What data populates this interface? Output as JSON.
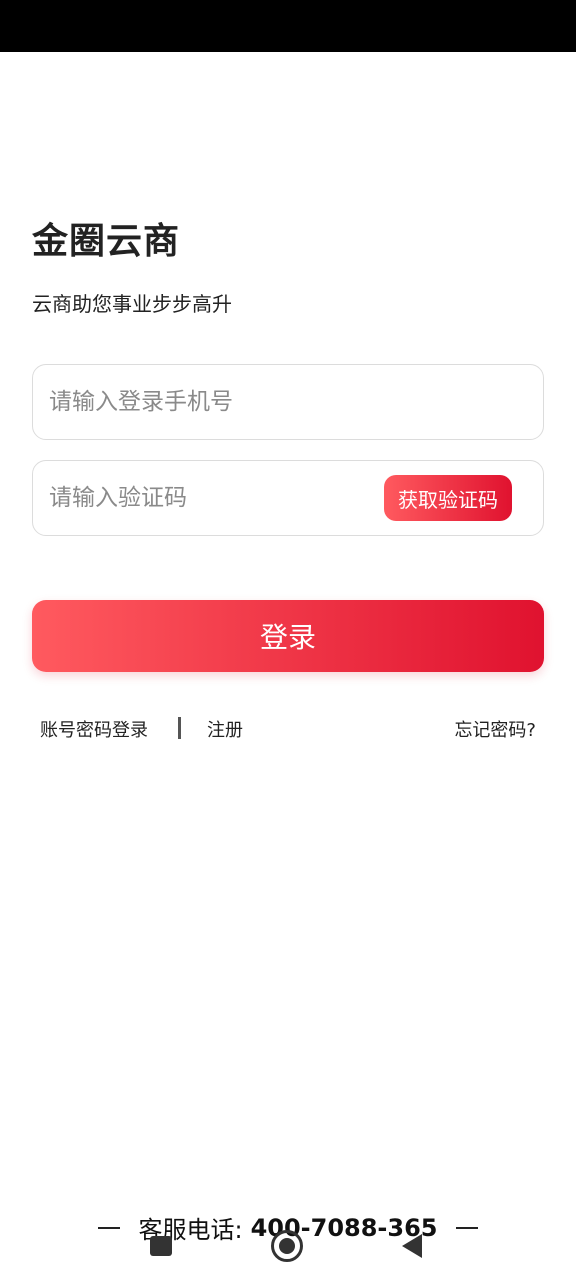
{
  "header": {
    "title": "金圈云商",
    "subtitle": "云商助您事业步步高升"
  },
  "form": {
    "phone_placeholder": "请输入登录手机号",
    "code_placeholder": "请输入验证码",
    "get_code_label": "获取验证码",
    "login_label": "登录"
  },
  "links": {
    "password_login": "账号密码登录",
    "register": "注册",
    "forgot_password": "忘记密码?"
  },
  "service": {
    "label": "客服电话:",
    "phone": "400-7088-365"
  },
  "colors": {
    "accent_start": "#ff5a5f",
    "accent_end": "#e0122f"
  },
  "navigation": {
    "recents": "square-icon",
    "home": "circle-home-icon",
    "back": "triangle-back-icon"
  }
}
